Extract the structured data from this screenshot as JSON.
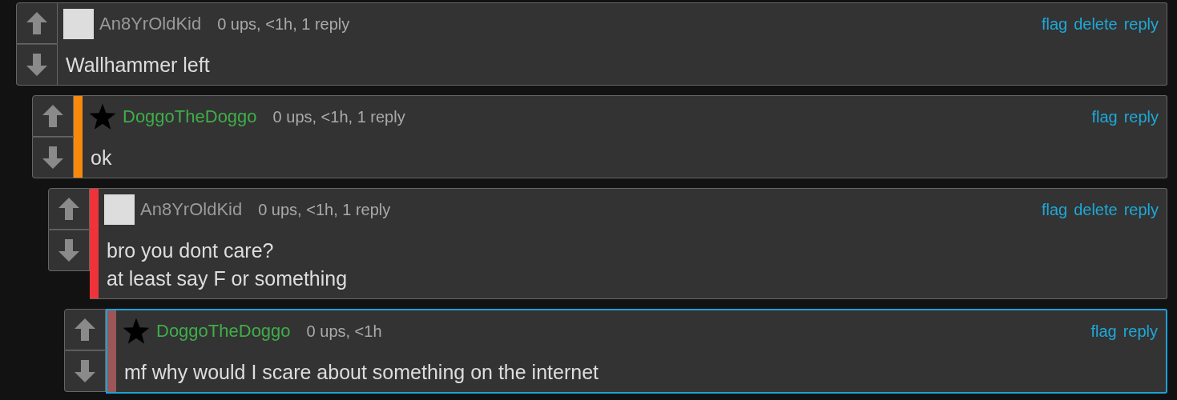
{
  "comments": [
    {
      "avatar": {
        "kind": "square"
      },
      "user": {
        "name": "An8YrOldKid",
        "color": "#9a9a9a"
      },
      "meta": "0 ups, <1h, 1 reply",
      "actions": [
        "flag",
        "delete",
        "reply"
      ],
      "lines": [
        "Wallhammer left"
      ],
      "highlighted": false,
      "children": [
        {
          "avatar": {
            "kind": "star"
          },
          "user": {
            "name": "DoggoTheDoggo",
            "color": "#3fae49"
          },
          "meta": "0 ups, <1h, 1 reply",
          "actions": [
            "flag",
            "reply"
          ],
          "lines": [
            "ok"
          ],
          "stripe": {
            "color": "#f7890c"
          },
          "highlighted": false,
          "children": [
            {
              "avatar": {
                "kind": "square"
              },
              "user": {
                "name": "An8YrOldKid",
                "color": "#9a9a9a"
              },
              "meta": "0 ups, <1h, 1 reply",
              "actions": [
                "flag",
                "delete",
                "reply"
              ],
              "lines": [
                "bro you dont care?",
                "at least say F or something"
              ],
              "stripe": {
                "color": "#f0333a"
              },
              "highlighted": false,
              "children": [
                {
                  "avatar": {
                    "kind": "star"
                  },
                  "user": {
                    "name": "DoggoTheDoggo",
                    "color": "#3fae49"
                  },
                  "meta": "0 ups, <1h",
                  "actions": [
                    "flag",
                    "reply"
                  ],
                  "lines": [
                    "mf why would I scare about something on the internet"
                  ],
                  "stripe": {
                    "color": "#9b5657"
                  },
                  "highlighted": true
                }
              ]
            }
          ]
        }
      ]
    }
  ]
}
